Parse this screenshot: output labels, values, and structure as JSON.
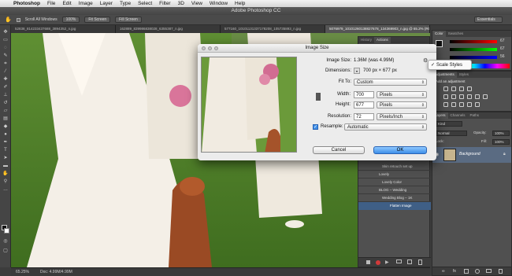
{
  "menubar": {
    "app": "Photoshop",
    "items": [
      "File",
      "Edit",
      "Image",
      "Layer",
      "Type",
      "Select",
      "Filter",
      "3D",
      "View",
      "Window",
      "Help"
    ]
  },
  "titlebar": {
    "title": "Adobe Photoshop CC"
  },
  "optionsbar": {
    "scroll_all_windows": "Scroll All Windows",
    "zoom": "100%",
    "fit_screen": "Fit Screen",
    "fill_screen": "Fill Screen",
    "workspace": "Essentials"
  },
  "doc_tabs": [
    "52838_814233437688_3894352_n.jpg",
    "162889_839986838028_6355387_n.jpg",
    "577160_10101131337178208_105735893_n.jpg",
    "5076979_10101260138827678_134369903_n.jpg @ 65.2% (RGB/8) *"
  ],
  "status": {
    "zoom": "65.25%",
    "doc": "Doc: 4.99M/4.99M"
  },
  "dialog": {
    "title": "Image Size",
    "image_size_label": "Image Size:",
    "image_size_value": "1.36M (was 4.99M)",
    "dimensions_label": "Dimensions:",
    "dimensions_value": "700 px × 677 px",
    "fit_to_label": "Fit To:",
    "fit_to_value": "Custom",
    "width_label": "Width:",
    "width_value": "700",
    "width_unit": "Pixels",
    "height_label": "Height:",
    "height_value": "677",
    "height_unit": "Pixels",
    "resolution_label": "Resolution:",
    "resolution_value": "72",
    "resolution_unit": "Pixels/Inch",
    "resample_label": "Resample:",
    "resample_value": "Automatic",
    "cancel": "Cancel",
    "ok": "OK"
  },
  "popup": {
    "label": "Scale Styles"
  },
  "panels": {
    "color_tabs": [
      "Color",
      "Swatches"
    ],
    "color_values": [
      "67",
      "67",
      "56"
    ],
    "history_tabs": [
      "History",
      "Actions"
    ],
    "adjustments_tabs": [
      "Adjustments",
      "Styles"
    ],
    "add_adjustment": "Add an adjustment",
    "layers_tabs": [
      "Layers",
      "Channels",
      "Paths"
    ],
    "layers_kind": "Kind",
    "layers_blend": "Normal",
    "opacity_label": "Opacity:",
    "opacity_value": "100%",
    "lock_label": "Lock:",
    "fill_label": "Fill:",
    "fill_value": "100%",
    "layer_name": "Background",
    "actions": [
      "Skin retouch set up",
      "Lovely",
      "Lovely Color",
      "BLOG – Wedding",
      "Wedding Blog – 1K",
      "Flatten Image"
    ]
  },
  "colors": {
    "accent": "#3d8ee8",
    "selected_action": "#3f5f86",
    "record_red": "#d23a3a"
  }
}
